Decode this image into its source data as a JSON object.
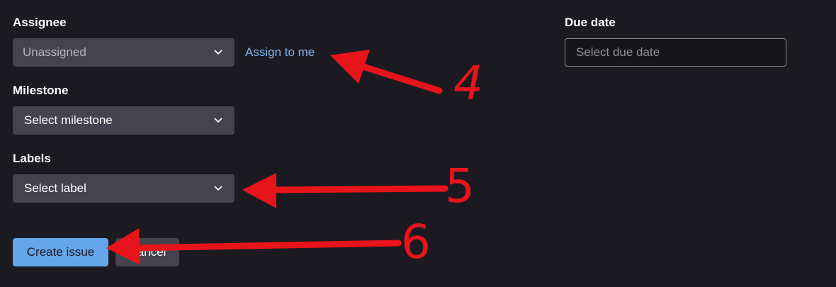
{
  "form": {
    "assignee": {
      "label": "Assignee",
      "value": "Unassigned",
      "assign_to_me": "Assign to me"
    },
    "milestone": {
      "label": "Milestone",
      "value": "Select milestone"
    },
    "labels": {
      "label": "Labels",
      "value": "Select label"
    },
    "due_date": {
      "label": "Due date",
      "placeholder": "Select due date"
    }
  },
  "actions": {
    "create_label": "Create issue",
    "cancel_label": "Cancel"
  },
  "annotations": {
    "color": "#e8141b",
    "numbers": [
      "4",
      "5",
      "6"
    ]
  }
}
